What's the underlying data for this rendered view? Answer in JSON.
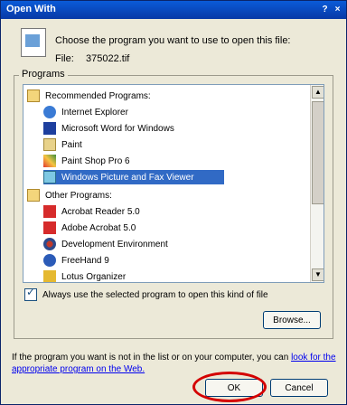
{
  "title": "Open With",
  "window_controls": {
    "help": "?",
    "close": "×"
  },
  "intro": "Choose the program you want to use to open this file:",
  "file": {
    "label": "File:",
    "name": "375022.tif"
  },
  "group_title": "Programs",
  "list": {
    "recommended_header": "Recommended Programs:",
    "recommended": [
      "Internet Explorer",
      "Microsoft Word for Windows",
      "Paint",
      "Paint Shop Pro 6",
      "Windows Picture and Fax Viewer"
    ],
    "other_header": "Other Programs:",
    "other": [
      "Acrobat Reader 5.0",
      "Adobe Acrobat 5.0",
      "Development Environment",
      "FreeHand 9",
      "Lotus Organizer"
    ]
  },
  "always_use": {
    "label": "Always use the selected program to open this kind of file",
    "checked": true
  },
  "browse_label": "Browse...",
  "hint": {
    "text": "If the program you want is not in the list or on your computer, you can ",
    "link": "look for the appropriate program on the Web."
  },
  "buttons": {
    "ok": "OK",
    "cancel": "Cancel"
  },
  "colors": {
    "selection": "#316AC5",
    "annotation_circle": "#D40000"
  }
}
